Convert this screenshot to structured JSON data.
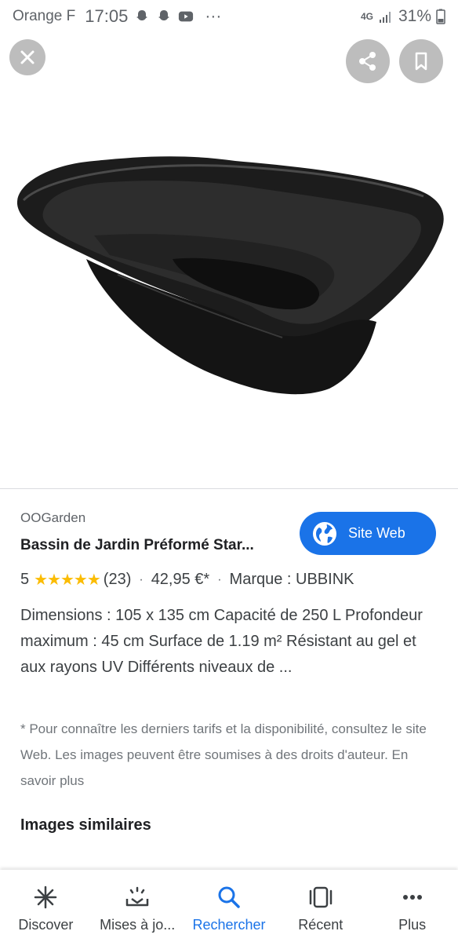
{
  "status_bar": {
    "carrier": "Orange F",
    "time": "17:05",
    "overflow": "···",
    "network": "4G",
    "battery": "31%"
  },
  "top_buttons": {
    "close_icon": "close-icon",
    "share_icon": "share-icon",
    "bookmark_icon": "bookmark-icon"
  },
  "product": {
    "source": "OOGarden",
    "title": "Bassin de Jardin Préformé Star...",
    "site_button": "Site Web",
    "rating": "5",
    "stars": "★★★★★",
    "reviews": "(23)",
    "price": "42,95 €*",
    "brand": "Marque : UBBINK",
    "separator": "·",
    "description": "Dimensions : 105 x 135 cm Capacité de 250 L Profondeur maximum : 45 cm Surface de 1.19 m² Résistant au gel et aux rayons UV Différents niveaux de ...",
    "disclaimer": "* Pour connaître les derniers tarifs et la disponibilité, consultez le site Web. Les images peuvent être soumises à des droits d'auteur. En savoir plus"
  },
  "similar_images_title": "Images similaires",
  "bottom_nav": [
    {
      "label": "Discover",
      "icon": "asterisk-icon"
    },
    {
      "label": "Mises à jo...",
      "icon": "updates-icon"
    },
    {
      "label": "Rechercher",
      "icon": "search-icon"
    },
    {
      "label": "Récent",
      "icon": "recent-icon"
    },
    {
      "label": "Plus",
      "icon": "more-icon"
    }
  ],
  "colors": {
    "accent": "#1a73e8",
    "star": "#fbbc04",
    "button_grey": "#bdbdbd"
  }
}
